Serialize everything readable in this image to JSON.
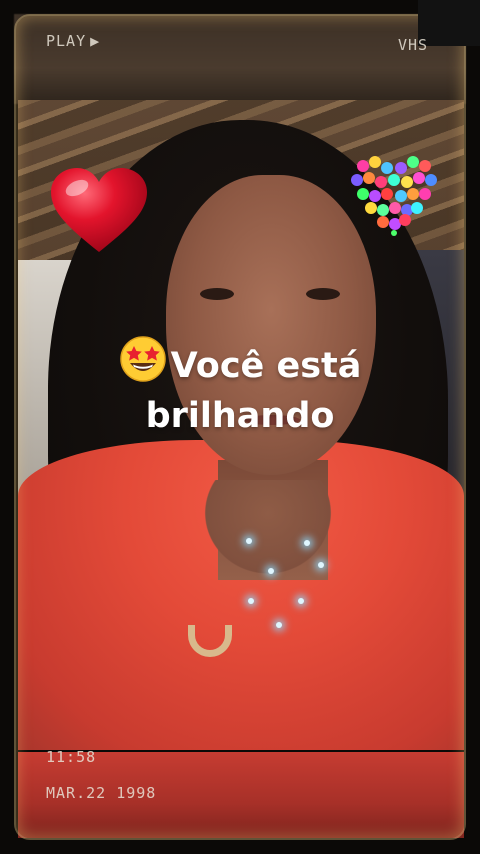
{
  "overlay": {
    "play_label": "PLAY",
    "play_glyph": "▶",
    "format_label": "VHS",
    "time": "11:58",
    "date": "MAR.22 1998"
  },
  "caption": {
    "line1": "Você está",
    "line2": "brilhando"
  },
  "stickers": {
    "left": "red-heart",
    "right": "multicolor-heart",
    "caption_emoji": "star-struck-emoji"
  },
  "colors": {
    "shirt": "#e34a38",
    "heart_red": "#e0102a",
    "frame_glow": "#ffd88a",
    "caption_text": "#ffffff"
  }
}
